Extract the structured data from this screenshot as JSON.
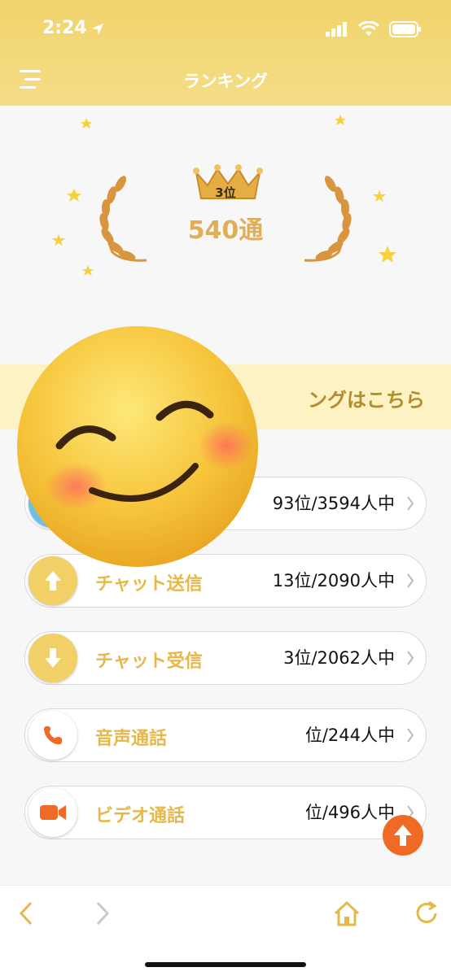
{
  "status_bar": {
    "time": "2:24"
  },
  "header": {
    "title": "ランキング"
  },
  "rank_badge": {
    "rank": "3位",
    "count": "540通"
  },
  "banner": {
    "text": "ングはこちら"
  },
  "rows": [
    {
      "label": "",
      "value": "93位/3594人中",
      "icon": "blue-icon"
    },
    {
      "label": "チャット送信",
      "value": "13位/2090人中",
      "icon": "arrow-up-icon"
    },
    {
      "label": "チャット受信",
      "value": "3位/2062人中",
      "icon": "arrow-down-icon"
    },
    {
      "label": "音声通話",
      "value": "位/244人中",
      "icon": "phone-icon"
    },
    {
      "label": "ビデオ通話",
      "value": "位/496人中",
      "icon": "video-icon"
    }
  ],
  "colors": {
    "header": "#f3d97b",
    "accent": "#e6b84a",
    "orange": "#ef6b25",
    "banner_bg": "#fdf2c4"
  }
}
